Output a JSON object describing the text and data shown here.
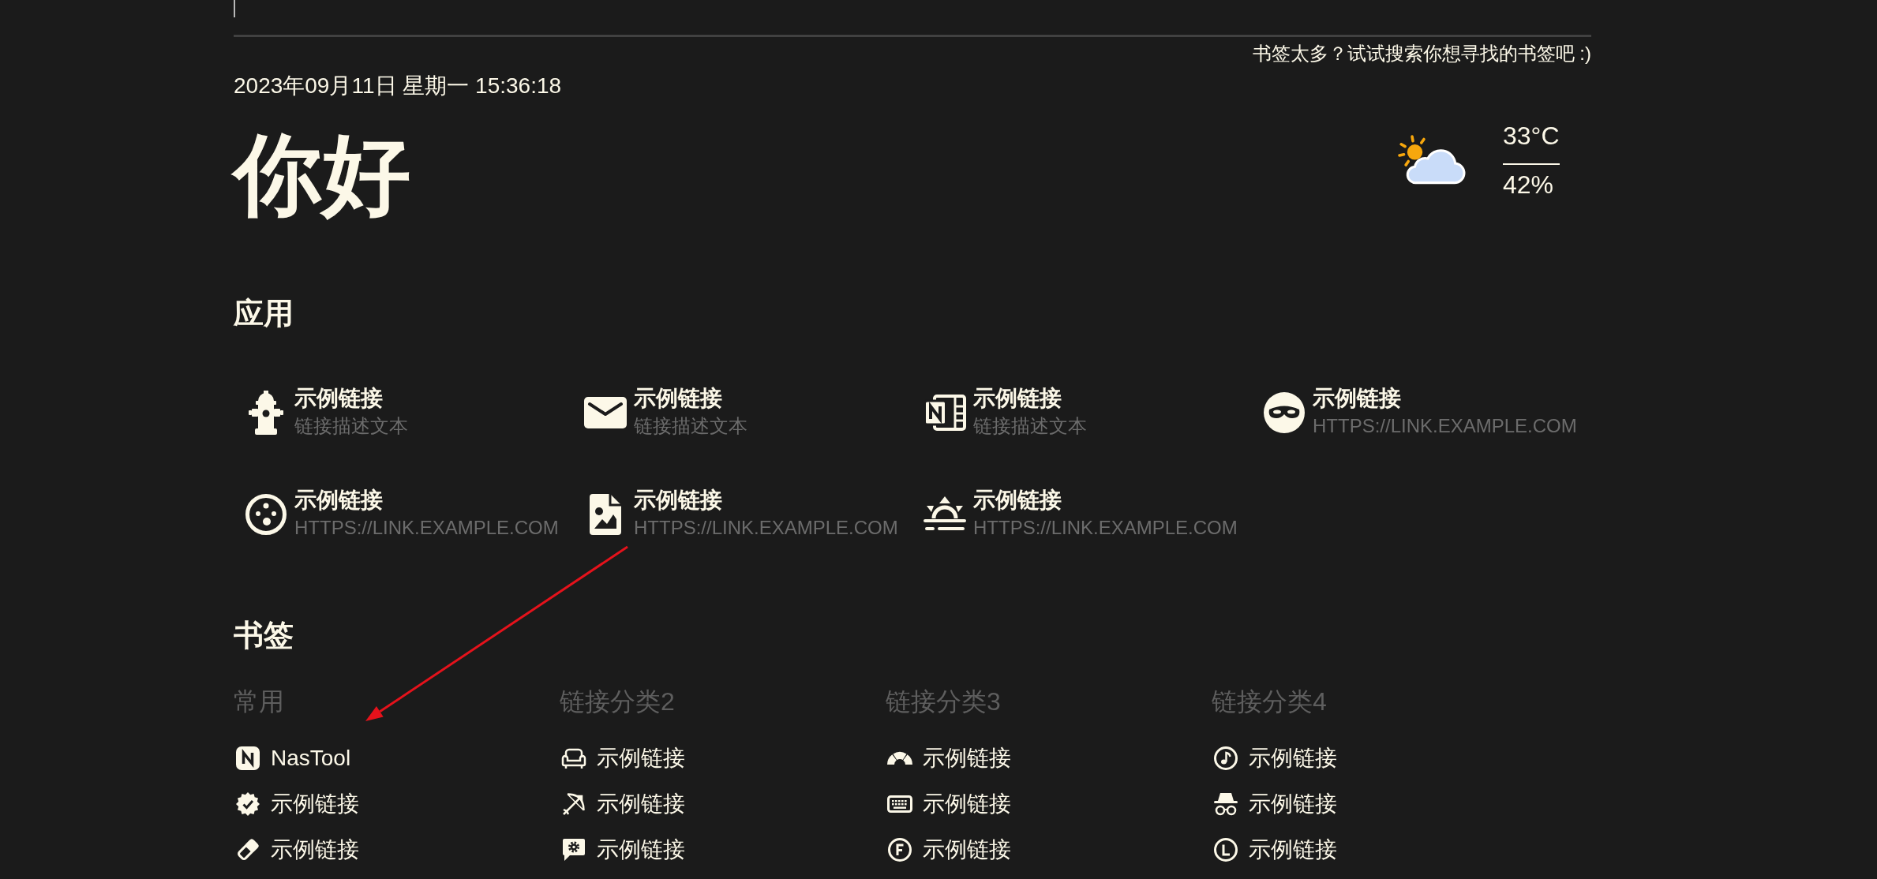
{
  "search": {
    "focused": true,
    "hint": "书签太多？试试搜索你想寻找的书签吧 :)"
  },
  "datetime": "2023年09月11日 星期一 15:36:18",
  "greeting": "你好",
  "weather": {
    "temperature": "33°C",
    "humidity": "42%"
  },
  "apps": {
    "title": "应用",
    "items": [
      {
        "title": "示例链接",
        "description": "链接描述文本"
      },
      {
        "title": "示例链接",
        "description": "链接描述文本"
      },
      {
        "title": "示例链接",
        "description": "链接描述文本"
      },
      {
        "title": "示例链接",
        "description": "HTTPS://LINK.EXAMPLE.COM"
      },
      {
        "title": "示例链接",
        "description": "HTTPS://LINK.EXAMPLE.COM"
      },
      {
        "title": "示例链接",
        "description": "HTTPS://LINK.EXAMPLE.COM"
      },
      {
        "title": "示例链接",
        "description": "HTTPS://LINK.EXAMPLE.COM"
      }
    ]
  },
  "bookmarks": {
    "title": "书签",
    "categories": [
      {
        "name": "常用",
        "links": [
          {
            "title": "NasTool"
          },
          {
            "title": "示例链接"
          },
          {
            "title": "示例链接"
          }
        ]
      },
      {
        "name": "链接分类2",
        "links": [
          {
            "title": "示例链接"
          },
          {
            "title": "示例链接"
          },
          {
            "title": "示例链接"
          }
        ]
      },
      {
        "name": "链接分类3",
        "links": [
          {
            "title": "示例链接"
          },
          {
            "title": "示例链接"
          },
          {
            "title": "示例链接"
          }
        ]
      },
      {
        "name": "链接分类4",
        "links": [
          {
            "title": "示例链接"
          },
          {
            "title": "示例链接"
          },
          {
            "title": "示例链接"
          }
        ]
      }
    ]
  }
}
